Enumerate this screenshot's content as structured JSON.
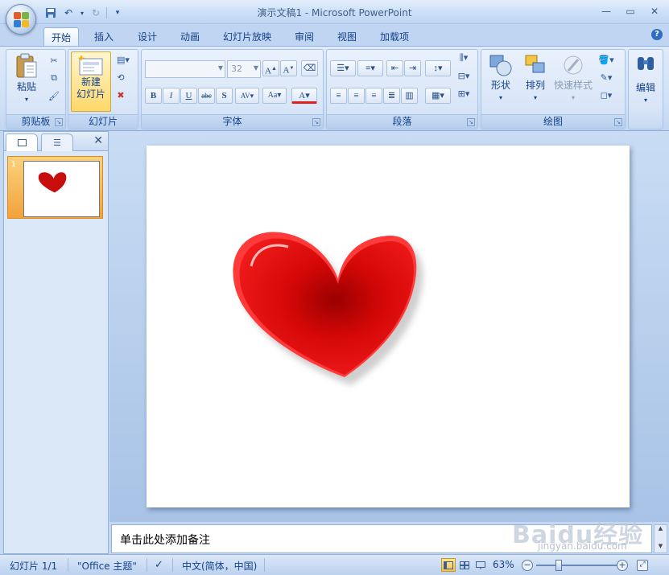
{
  "window": {
    "title": "演示文稿1 - Microsoft PowerPoint"
  },
  "ribbon": {
    "tabs": [
      "开始",
      "插入",
      "设计",
      "动画",
      "幻灯片放映",
      "审阅",
      "视图",
      "加载项"
    ],
    "active_tab": "开始",
    "groups": {
      "clipboard": {
        "label": "剪贴板",
        "paste_label": "粘贴"
      },
      "slides": {
        "label": "幻灯片",
        "new_slide_label_1": "新建",
        "new_slide_label_2": "幻灯片"
      },
      "font": {
        "label": "字体",
        "size_value": "32",
        "font_value": ""
      },
      "paragraph": {
        "label": "段落"
      },
      "drawing": {
        "label": "绘图",
        "shapes_label": "形状",
        "arrange_label": "排列",
        "quick_styles_label": "快速样式"
      },
      "editing": {
        "label": "编辑"
      }
    }
  },
  "slides_pane": {
    "thumb_number": "1"
  },
  "notes": {
    "placeholder": "单击此处添加备注"
  },
  "status": {
    "slide_count": "幻灯片 1/1",
    "theme": "\"Office 主题\"",
    "language": "中文(简体，中国)",
    "zoom": "63%"
  },
  "watermark": {
    "brand": "Baidu经验",
    "url": "jingyan.baidu.com"
  },
  "colors": {
    "heart_main": "#e01010",
    "heart_dark": "#a00000",
    "accent": "#f7c04c"
  }
}
